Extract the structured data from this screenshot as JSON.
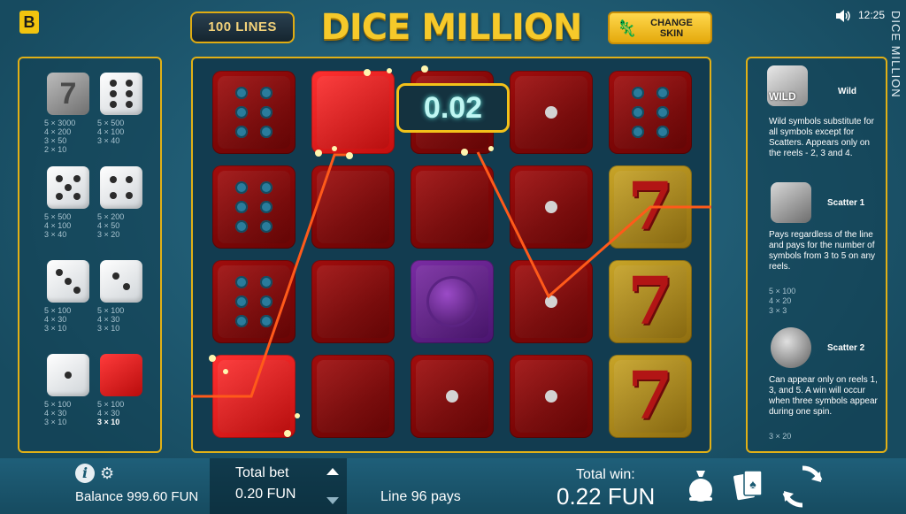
{
  "header": {
    "brand_letter": "B",
    "lines_label": "100 LINES",
    "title": "DICE MILLION",
    "change_skin_label": "CHANGE\nSKIN",
    "time": "12:25",
    "side_title": "DICE MILLION"
  },
  "paytable": [
    {
      "symbol": "seven",
      "pays": [
        "5 × 3000",
        "4 × 200",
        "3 × 50",
        "2 × 10"
      ]
    },
    {
      "symbol": "six",
      "pays": [
        "5 × 500",
        "4 × 100",
        "3 × 40"
      ]
    },
    {
      "symbol": "five",
      "pays": [
        "5 × 500",
        "4 × 100",
        "3 × 40"
      ]
    },
    {
      "symbol": "four",
      "pays": [
        "5 × 200",
        "4 × 50",
        "3 × 20"
      ]
    },
    {
      "symbol": "three",
      "pays": [
        "5 × 100",
        "4 × 30",
        "3 × 10"
      ]
    },
    {
      "symbol": "two",
      "pays": [
        "5 × 100",
        "4 × 30",
        "3 × 10"
      ]
    },
    {
      "symbol": "one",
      "pays": [
        "5 × 100",
        "4 × 30",
        "3 × 10"
      ]
    },
    {
      "symbol": "blank",
      "pays": [
        "5 × 100",
        "4 × 30",
        "3 × 10"
      ],
      "highlight": "3 × 10"
    }
  ],
  "reels": {
    "win_amount": "0.02"
  },
  "info": {
    "wild_name": "Wild",
    "wild_badge": "WILD",
    "wild_desc": "Wild symbols substitute for all symbols except for Scatters. Appears only on the reels - 2, 3 and 4.",
    "scatter1_name": "Scatter 1",
    "scatter1_desc": "Pays regardless of the line and pays for the number of symbols from 3 to 5 on any reels.",
    "scatter1_pays": [
      "5 × 100",
      "4 × 20",
      "3 × 3"
    ],
    "scatter2_name": "Scatter 2",
    "scatter2_desc": "Can appear only on reels 1, 3, and 5. A win will occur when three symbols appear during one spin.",
    "scatter2_pays": [
      "3 × 20"
    ]
  },
  "footer": {
    "balance": "Balance 999.60 FUN",
    "total_bet_label": "Total bet",
    "total_bet_value": "0.20 FUN",
    "line_pays": "Line 96 pays",
    "total_win_label": "Total win:",
    "total_win_value": "0.22 FUN"
  },
  "colors": {
    "accent_gold": "#e1b016",
    "background": "#1d5a73",
    "win_line": "#ff5a1a"
  }
}
